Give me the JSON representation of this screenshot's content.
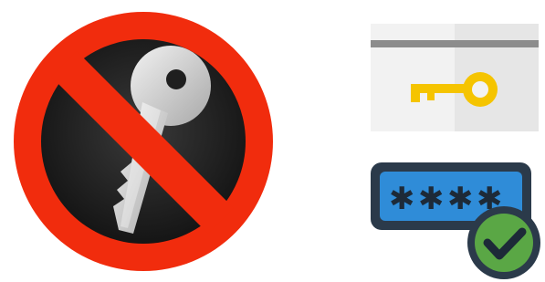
{
  "icons": [
    {
      "name": "no-key-prohibited-icon",
      "colors": {
        "ring": "#f12c0d",
        "disc": "#1f1f1f",
        "key": "#d9d9d9"
      }
    },
    {
      "name": "key-card-icon",
      "colors": {
        "card": "#f2f2f2",
        "stripe": "#8c8c8c",
        "key": "#f5c400"
      }
    },
    {
      "name": "password-verified-icon",
      "colors": {
        "field": "#2f8cd8",
        "frame": "#2b3a4a",
        "dots": "#1d2a38",
        "check": "#5aa745"
      }
    }
  ]
}
